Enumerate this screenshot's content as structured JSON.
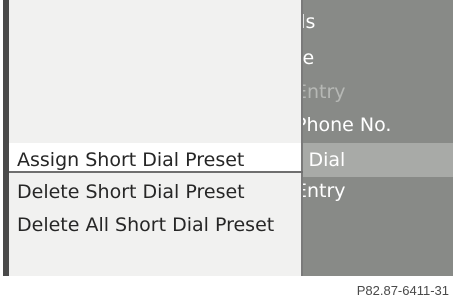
{
  "background_menu": {
    "items": [
      {
        "label": "ils",
        "state": "normal"
      },
      {
        "label": "te",
        "state": "normal"
      },
      {
        "label": "Entry",
        "state": "disabled"
      },
      {
        "label": "Phone No.",
        "state": "normal"
      },
      {
        "label": "t Dial",
        "state": "highlighted"
      },
      {
        "label": "Entry",
        "state": "normal"
      }
    ]
  },
  "popup_menu": {
    "items": [
      {
        "label": "Assign Short Dial Preset",
        "selected": true
      },
      {
        "label": "Delete Short Dial Preset",
        "selected": false
      },
      {
        "label": "Delete All Short Dial Preset",
        "selected": false
      }
    ]
  },
  "footer": {
    "code": "P82.87-6411-31"
  },
  "colors": {
    "display_background": "#888a87",
    "popup_background": "#f1f1f0",
    "selection_background": "#ffffff",
    "text_dark": "#262626",
    "text_light": "#ffffff"
  }
}
